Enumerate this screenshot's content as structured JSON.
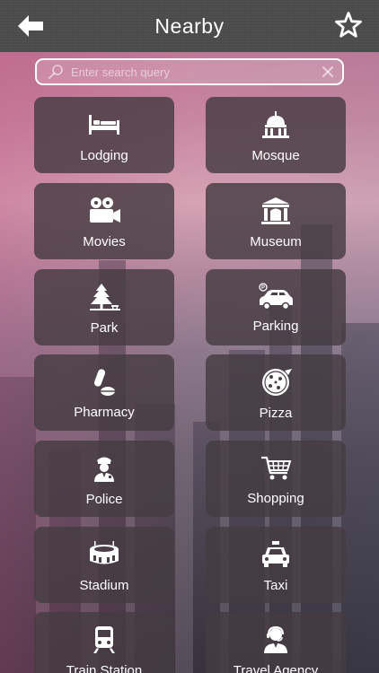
{
  "header": {
    "title": "Nearby",
    "back_icon": "back-arrow-icon",
    "favorite_icon": "star-icon"
  },
  "search": {
    "placeholder": "Enter search query",
    "value": ""
  },
  "categories": [
    {
      "label": "Lodging",
      "icon": "bed-icon"
    },
    {
      "label": "Mosque",
      "icon": "mosque-icon"
    },
    {
      "label": "Movies",
      "icon": "film-camera-icon"
    },
    {
      "label": "Museum",
      "icon": "museum-icon"
    },
    {
      "label": "Park",
      "icon": "tree-icon"
    },
    {
      "label": "Parking",
      "icon": "car-icon"
    },
    {
      "label": "Pharmacy",
      "icon": "pills-icon"
    },
    {
      "label": "Pizza",
      "icon": "pizza-icon"
    },
    {
      "label": "Police",
      "icon": "police-officer-icon"
    },
    {
      "label": "Shopping",
      "icon": "shopping-cart-icon"
    },
    {
      "label": "Stadium",
      "icon": "stadium-icon"
    },
    {
      "label": "Taxi",
      "icon": "taxi-icon"
    },
    {
      "label": "Train Station",
      "icon": "train-icon"
    },
    {
      "label": "Travel Agency",
      "icon": "agent-icon"
    }
  ],
  "colors": {
    "header_bg": "#4a4a4a",
    "tile_bg": "#463c42",
    "text": "#ffffff"
  }
}
